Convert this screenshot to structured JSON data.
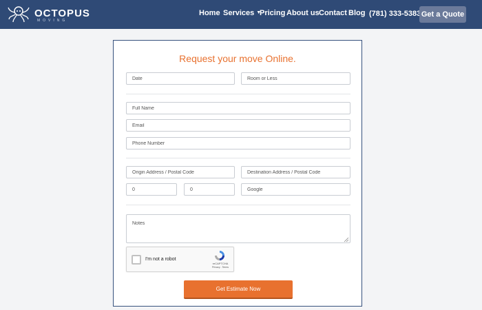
{
  "brand": {
    "name": "OCTOPUS",
    "tagline": "MOVING"
  },
  "nav": {
    "links": [
      "Home",
      "Services",
      "Pricing",
      "About us",
      "Contact",
      "Blog"
    ],
    "phone": "(781) 333-5383",
    "cta": "Get a Quote"
  },
  "form": {
    "title": "Request your move Online.",
    "date_placeholder": "Date",
    "size_value": "Room or Less",
    "full_name_placeholder": "Full Name",
    "email_placeholder": "Email",
    "phone_placeholder": "Phone Number",
    "origin_placeholder": "Origin Address / Postal Code",
    "destination_placeholder": "Destination Address / Postal Code",
    "field_a_value": "0",
    "field_b_value": "0",
    "google_value": "Google",
    "notes_placeholder": "Notes",
    "captcha": {
      "label": "I'm not a robot",
      "brand": "reCAPTCHA",
      "terms": "Privacy - Terms"
    },
    "submit_label": "Get Estimate Now"
  },
  "colors": {
    "nav_bg": "#2f4a76",
    "accent": "#e8712f",
    "quote_button_bg": "#6b7a9a"
  }
}
